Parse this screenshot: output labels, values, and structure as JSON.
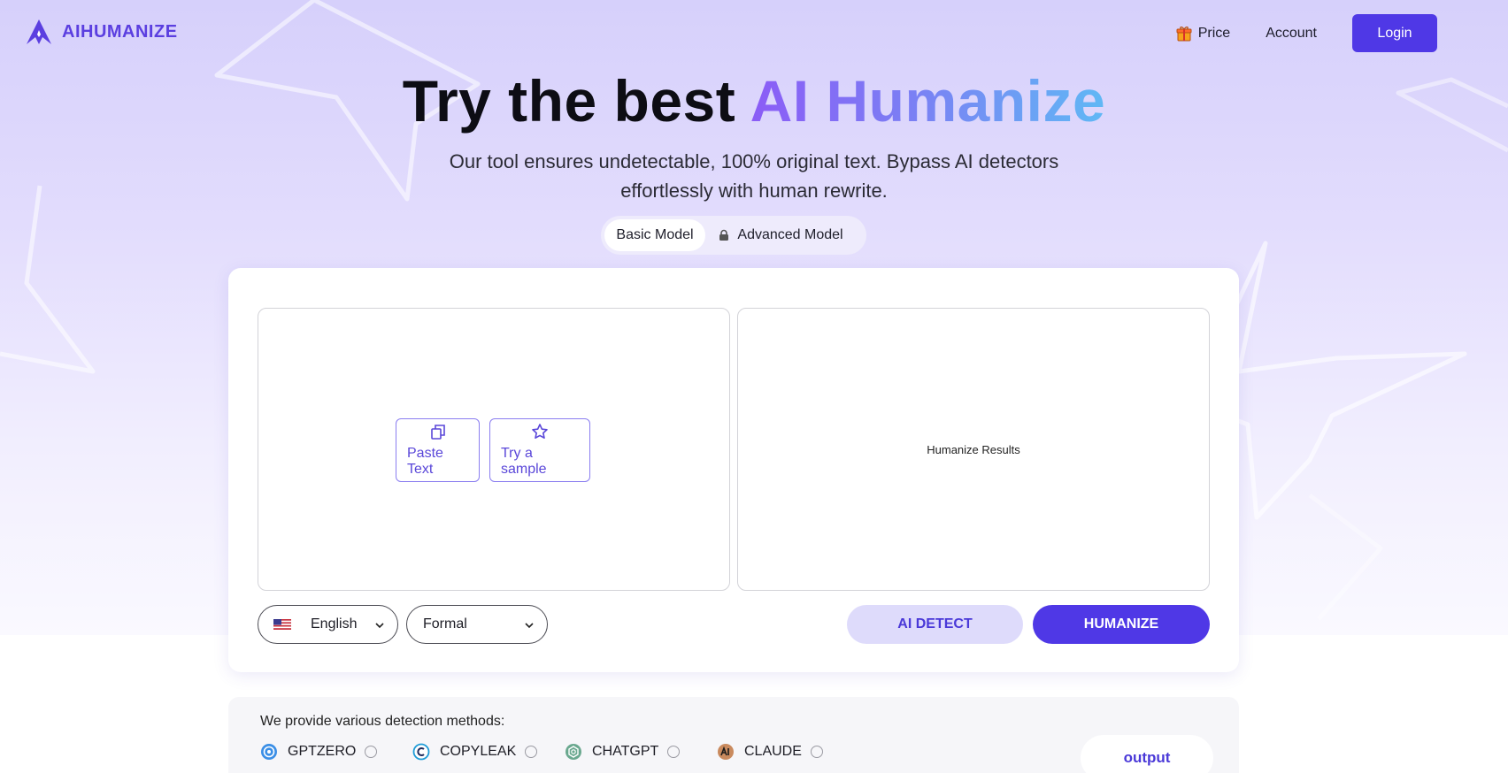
{
  "brand": {
    "name": "AIHUMANIZE",
    "logo_icon": "a-star-logo-icon",
    "color": "#5b3fe0"
  },
  "nav": {
    "price": "Price",
    "price_icon": "gift-icon",
    "account": "Account",
    "login": "Login"
  },
  "hero": {
    "title_prefix": "Try the best ",
    "title_ai": "AI",
    "title_humanize": "Humanize",
    "subtitle_line1": "Our tool ensures undetectable, 100% original text. Bypass AI detectors",
    "subtitle_line2": "effortlessly with human rewrite."
  },
  "models": {
    "basic": "Basic Model",
    "advanced": "Advanced Model",
    "advanced_icon": "lock-icon",
    "selected": "Basic Model"
  },
  "editor": {
    "paste_label": "Paste Text",
    "sample_label": "Try a sample",
    "results_label": "Humanize Results"
  },
  "controls": {
    "language": "English",
    "tone": "Formal",
    "ai_detect": "AI DETECT",
    "humanize": "HUMANIZE"
  },
  "detection": {
    "title": "We provide various detection methods:",
    "methods": [
      {
        "label": "GPTZERO",
        "icon": "gptzero-logo-icon"
      },
      {
        "label": "COPYLEAK",
        "icon": "copyleak-logo-icon"
      },
      {
        "label": "CHATGPT",
        "icon": "chatgpt-logo-icon"
      },
      {
        "label": "CLAUDE",
        "icon": "claude-logo-icon"
      }
    ],
    "output": "output"
  },
  "colors": {
    "accent": "#4f38e6",
    "accent_light": "#dedbfb",
    "hero_bg": "#d6d0fb"
  }
}
